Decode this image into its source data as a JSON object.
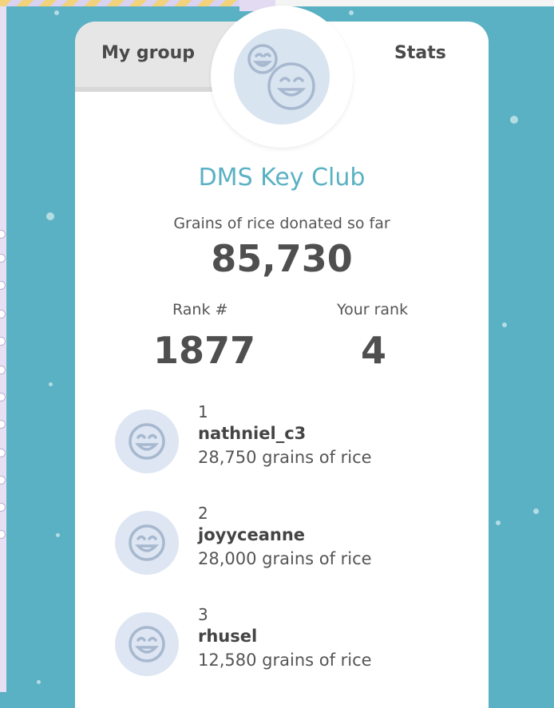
{
  "tabs": {
    "my_group": "My group",
    "stats": "Stats"
  },
  "group": {
    "name": "DMS Key Club",
    "donated_label": "Grains of rice donated so far",
    "donated_total": "85,730"
  },
  "ranks": {
    "group_rank_label": "Rank #",
    "group_rank_value": "1877",
    "your_rank_label": "Your rank",
    "your_rank_value": "4"
  },
  "members": [
    {
      "position": "1",
      "name": "nathniel_c3",
      "grains": "28,750 grains of rice"
    },
    {
      "position": "2",
      "name": "joyyceanne",
      "grains": "28,000 grains of rice"
    },
    {
      "position": "3",
      "name": "rhusel",
      "grains": "12,580 grains of rice"
    }
  ],
  "icons": {
    "group_avatar": "group-smiley-icon",
    "member_avatar": "smiley-face-icon"
  },
  "colors": {
    "background": "#5ab1c3",
    "accent": "#5ab1c3",
    "avatar_bg": "#d9e4f1",
    "icon_stroke": "#a7b8cf"
  }
}
